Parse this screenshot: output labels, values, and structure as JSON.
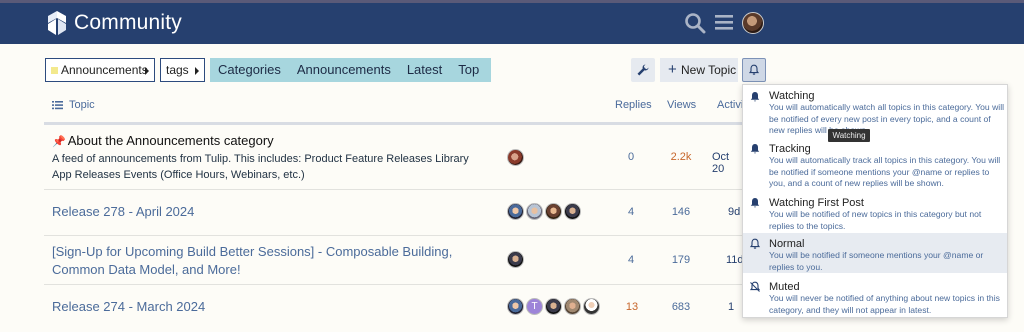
{
  "header": {
    "brand": "Community",
    "bg_color": "#26406f",
    "icons": [
      "logo-icon",
      "search-icon",
      "hamburger-menu-icon",
      "user-avatar"
    ]
  },
  "nav": {
    "category_crumb": "Announcements",
    "tags_crumb": "tags",
    "category_color": "#f3e98d",
    "tabs": [
      "Categories",
      "Announcements",
      "Latest",
      "Top"
    ],
    "tabs_bg": "#a7d6de",
    "new_topic_label": "New Topic"
  },
  "table": {
    "headers": {
      "topic": "Topic",
      "replies": "Replies",
      "views": "Views",
      "activity": "Activi"
    },
    "rows": [
      {
        "title": "About the Announcements category",
        "pinned": true,
        "excerpt": "A feed of announcements from Tulip. This includes: Product Feature Releases Library App Releases Events (Office Hours, Webinars, etc.)",
        "replies": "0",
        "views": "2.2k",
        "activity": "Oct 20"
      },
      {
        "title": "Release 278 - April 2024",
        "replies": "4",
        "views": "146",
        "activity": "9d"
      },
      {
        "title": "[Sign-Up for Upcoming Build Better Sessions] - Composable Building, Common Data Model, and More!",
        "replies": "4",
        "views": "179",
        "activity": "11d"
      },
      {
        "title": "Release 274 - March 2024",
        "replies": "13",
        "views": "683",
        "activity": "1"
      }
    ]
  },
  "avatar_letter": "T",
  "notifications": {
    "tooltip": "Watching",
    "options": [
      {
        "title": "Watching",
        "description": "You will automatically watch all topics in this category. You will be notified of every new post in every topic, and a count of new replies will be shown.",
        "icon": "bell-filled-icon"
      },
      {
        "title": "Tracking",
        "description": "You will automatically track all topics in this category. You will be notified if someone mentions your @name or replies to you, and a count of new replies will be shown.",
        "icon": "bell-filled-icon"
      },
      {
        "title": "Watching First Post",
        "description": "You will be notified of new topics in this category but not replies to the topics.",
        "icon": "bell-filled-icon"
      },
      {
        "title": "Normal",
        "description": "You will be notified if someone mentions your @name or replies to you.",
        "icon": "bell-outline-icon",
        "selected": true
      },
      {
        "title": "Muted",
        "description": "You will never be notified of anything about new topics in this category, and they will not appear in latest.",
        "icon": "bell-slash-icon"
      }
    ]
  }
}
